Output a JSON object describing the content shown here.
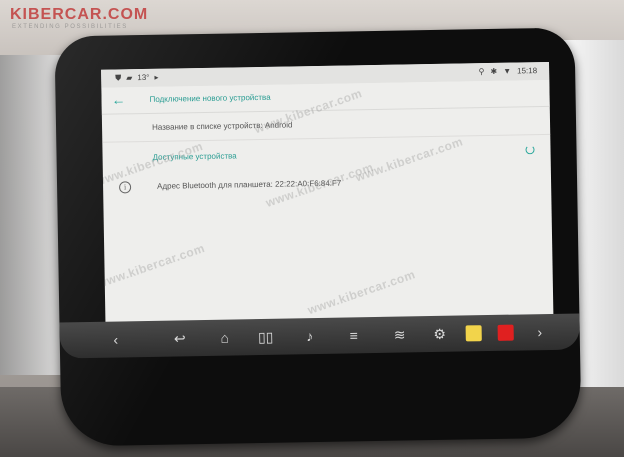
{
  "watermark_site": "KIBERCAR.COM",
  "watermark_tagline": "EXTENDING POSSIBILITIES",
  "watermark_text": "www.kibercar.com",
  "status_bar": {
    "temperature": "13°",
    "time": "15:18"
  },
  "toolbar": {
    "title": "Подключение нового устройства"
  },
  "settings": {
    "device_name_label": "Название в списке устройств: Android",
    "available_devices_label": "Доступные устройства",
    "bluetooth_address_label": "Адрес Bluetooth для планшета: 22:22:A0:F6:84:F7"
  },
  "nav_icons": [
    "chevron-left-icon",
    "back-icon",
    "home-icon",
    "recent-apps-icon",
    "volume-icon",
    "menu-icon",
    "wifi-icon",
    "settings-icon",
    "navigation-app-icon",
    "youtube-icon",
    "chevron-right-icon"
  ],
  "colors": {
    "accent": "#2aa79b",
    "logo": "#be2828",
    "nav_app_tile": "#f2d44b",
    "youtube": "#e02020"
  }
}
